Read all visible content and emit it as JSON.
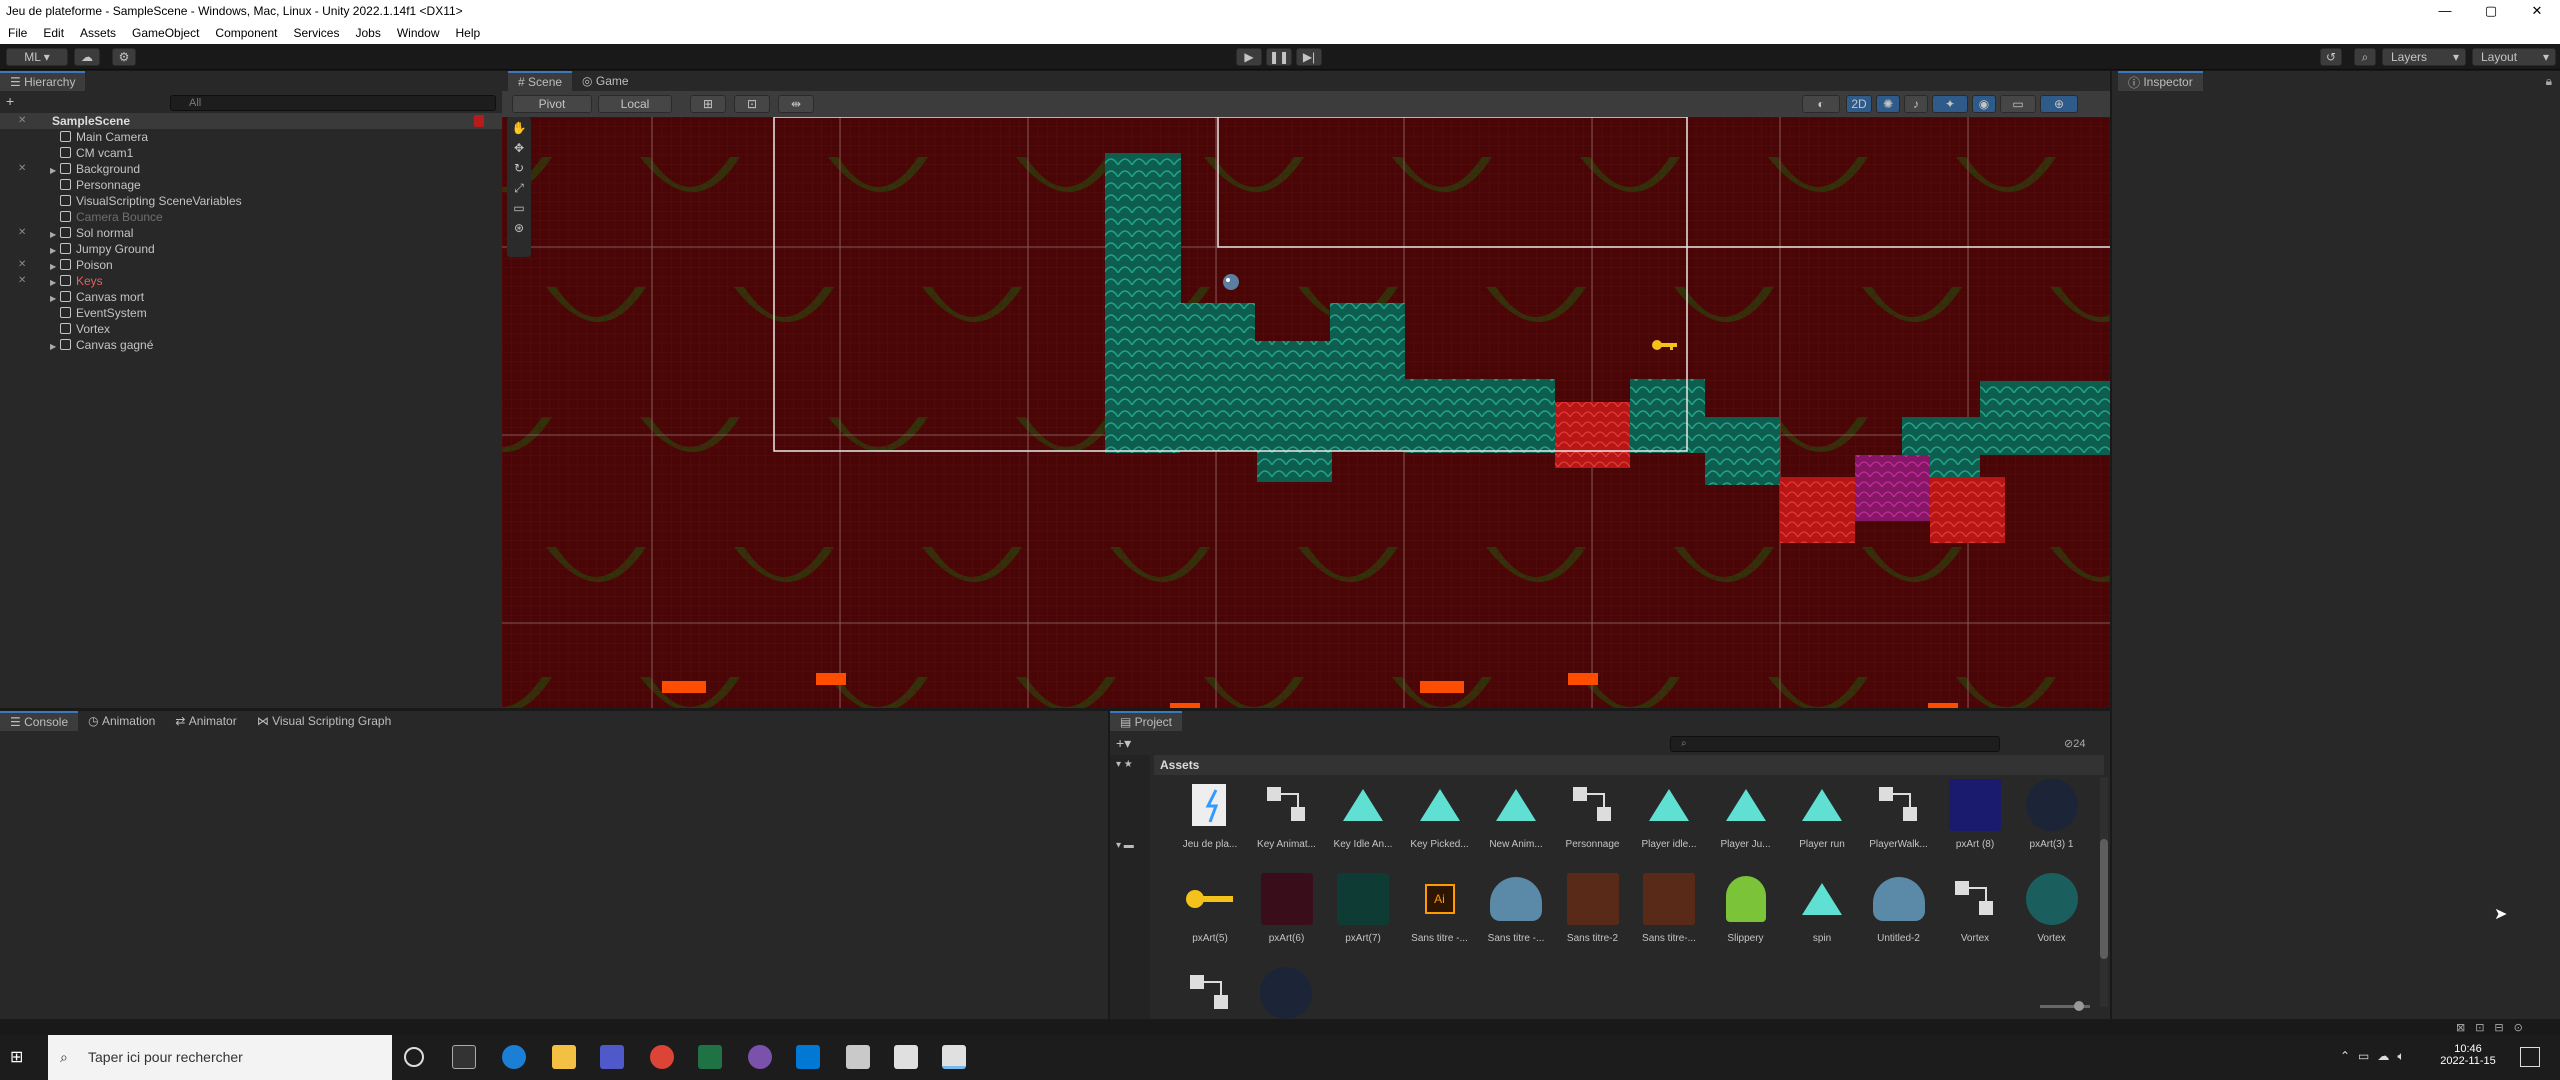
{
  "window": {
    "title": "Jeu de plateforme - SampleScene - Windows, Mac, Linux - Unity 2022.1.14f1 <DX11>",
    "minimize": "—",
    "maximize": "▢",
    "close": "✕"
  },
  "menu": [
    "File",
    "Edit",
    "Assets",
    "GameObject",
    "Component",
    "Services",
    "Jobs",
    "Window",
    "Help"
  ],
  "toolbar": {
    "account": "ML ▾",
    "layers": "Layers",
    "layout": "Layout"
  },
  "hierarchy": {
    "tab": "Hierarchy",
    "search_placeholder": "All",
    "scene": "SampleScene",
    "items": [
      {
        "label": "Main Camera"
      },
      {
        "label": "CM vcam1"
      },
      {
        "label": "Background"
      },
      {
        "label": "Personnage"
      },
      {
        "label": "VisualScripting SceneVariables"
      },
      {
        "label": "Camera Bounce"
      },
      {
        "label": "Sol normal"
      },
      {
        "label": "Jumpy Ground"
      },
      {
        "label": "Poison"
      },
      {
        "label": "Keys"
      },
      {
        "label": "Canvas mort"
      },
      {
        "label": "EventSystem"
      },
      {
        "label": "Vortex"
      },
      {
        "label": "Canvas gagné"
      }
    ]
  },
  "scene_tabs": {
    "scene": "Scene",
    "game": "Game"
  },
  "scene_toolbar": {
    "pivot": "Pivot",
    "local": "Local",
    "mode_2d": "2D"
  },
  "inspector": {
    "tab": "Inspector"
  },
  "bottom_tabs": [
    "Console",
    "Animation",
    "Animator",
    "Visual Scripting Graph"
  ],
  "project": {
    "tab": "Project",
    "folder": "Assets",
    "count": "24",
    "row1": [
      "Jeu de pla...",
      "Key Animat...",
      "Key Idle An...",
      "Key Picked...",
      "New Anim...",
      "Personnage",
      "Player idle...",
      "Player Ju...",
      "Player run",
      "PlayerWalk...",
      "pxArt (8)",
      "pxArt(3) 1"
    ],
    "row2": [
      "pxArt(5)",
      "pxArt(6)",
      "pxArt(7)",
      "Sans titre -...",
      "Sans titre -...",
      "Sans titre-2",
      "Sans titre-...",
      "Slippery",
      "spin",
      "Untitled-2",
      "Vortex",
      "Vortex"
    ]
  },
  "taskbar": {
    "search_placeholder": "Taper ici pour rechercher",
    "time": "10:46",
    "date": "2022-11-15"
  },
  "colors": {
    "scene_bg": "#4a0606",
    "tile_teal": "#0f6f5c",
    "tile_red": "#c01818",
    "tile_magenta": "#8a1a6e",
    "accent": "#3a79bb"
  }
}
